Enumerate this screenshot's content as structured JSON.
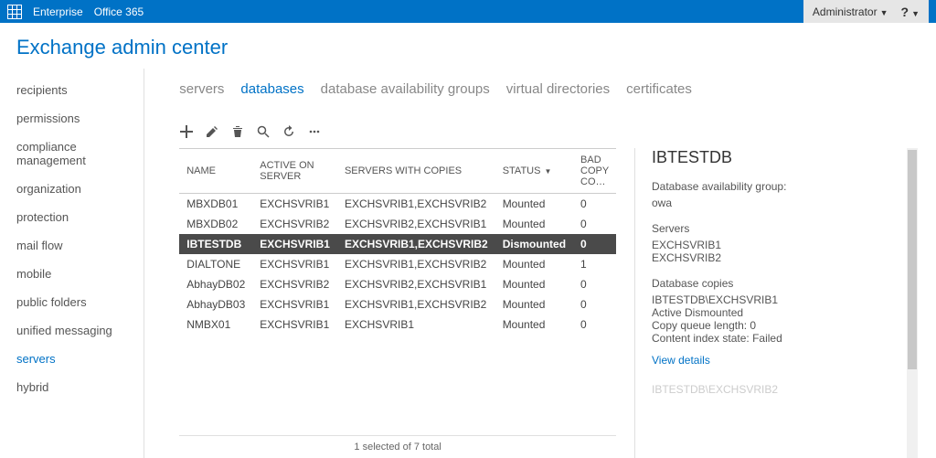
{
  "topbar": {
    "enterprise": "Enterprise",
    "office365": "Office 365",
    "admin": "Administrator"
  },
  "page_title": "Exchange admin center",
  "leftnav": [
    {
      "label": "recipients",
      "active": false
    },
    {
      "label": "permissions",
      "active": false
    },
    {
      "label": "compliance management",
      "active": false
    },
    {
      "label": "organization",
      "active": false
    },
    {
      "label": "protection",
      "active": false
    },
    {
      "label": "mail flow",
      "active": false
    },
    {
      "label": "mobile",
      "active": false
    },
    {
      "label": "public folders",
      "active": false
    },
    {
      "label": "unified messaging",
      "active": false
    },
    {
      "label": "servers",
      "active": true
    },
    {
      "label": "hybrid",
      "active": false
    }
  ],
  "tabs": [
    {
      "label": "servers",
      "active": false
    },
    {
      "label": "databases",
      "active": true
    },
    {
      "label": "database availability groups",
      "active": false
    },
    {
      "label": "virtual directories",
      "active": false
    },
    {
      "label": "certificates",
      "active": false
    }
  ],
  "table": {
    "headers": {
      "name": "NAME",
      "active_on": "ACTIVE ON SERVER",
      "servers_copies": "SERVERS WITH COPIES",
      "status": "STATUS",
      "bad_copy": "BAD COPY CO…"
    },
    "rows": [
      {
        "name": "MBXDB01",
        "active": "EXCHSVRIB1",
        "copies": "EXCHSVRIB1,EXCHSVRIB2",
        "status": "Mounted",
        "bad": "0",
        "selected": false
      },
      {
        "name": "MBXDB02",
        "active": "EXCHSVRIB2",
        "copies": "EXCHSVRIB2,EXCHSVRIB1",
        "status": "Mounted",
        "bad": "0",
        "selected": false
      },
      {
        "name": "IBTESTDB",
        "active": "EXCHSVRIB1",
        "copies": "EXCHSVRIB1,EXCHSVRIB2",
        "status": "Dismounted",
        "bad": "0",
        "selected": true
      },
      {
        "name": "DIALTONE",
        "active": "EXCHSVRIB1",
        "copies": "EXCHSVRIB1,EXCHSVRIB2",
        "status": "Mounted",
        "bad": "1",
        "selected": false
      },
      {
        "name": "AbhayDB02",
        "active": "EXCHSVRIB2",
        "copies": "EXCHSVRIB2,EXCHSVRIB1",
        "status": "Mounted",
        "bad": "0",
        "selected": false
      },
      {
        "name": "AbhayDB03",
        "active": "EXCHSVRIB1",
        "copies": "EXCHSVRIB1,EXCHSVRIB2",
        "status": "Mounted",
        "bad": "0",
        "selected": false
      },
      {
        "name": "NMBX01",
        "active": "EXCHSVRIB1",
        "copies": "EXCHSVRIB1",
        "status": "Mounted",
        "bad": "0",
        "selected": false
      }
    ]
  },
  "details": {
    "title": "IBTESTDB",
    "dag_label": "Database availability group:",
    "dag_value": "owa",
    "servers_label": "Servers",
    "server1": "EXCHSVRIB1",
    "server2": "EXCHSVRIB2",
    "copies_label": "Database copies",
    "copy_name": "IBTESTDB\\EXCHSVRIB1",
    "copy_status": "Active Dismounted",
    "queue": "Copy queue length: 0",
    "index": "Content index state: Failed",
    "view_details": "View details",
    "faded": "IBTESTDB\\EXCHSVRIB2"
  },
  "footer": "1 selected of 7 total"
}
